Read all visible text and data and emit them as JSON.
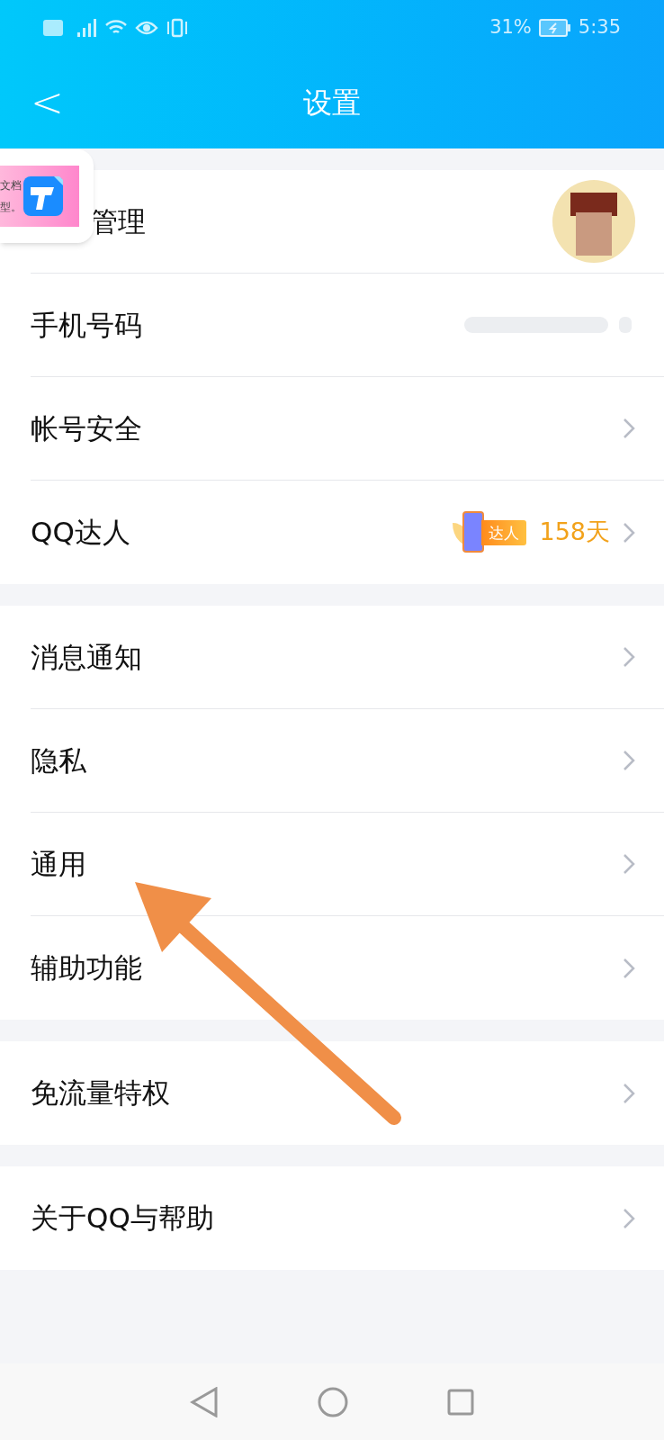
{
  "status_bar": {
    "battery": "31%",
    "time": "5:35"
  },
  "header": {
    "back": "<",
    "title": "设置"
  },
  "floating_widget": {
    "text_1": "文档",
    "text_2": "型。"
  },
  "sections": [
    {
      "rows": [
        {
          "label": "管理",
          "kind": "avatar",
          "covered": true
        },
        {
          "label": "手机号码",
          "kind": "blurred"
        },
        {
          "label": "帐号安全",
          "kind": "chevron"
        },
        {
          "label": "QQ达人",
          "kind": "badge",
          "badge": "达人",
          "value": "158天"
        }
      ]
    },
    {
      "rows": [
        {
          "label": "消息通知",
          "kind": "chevron"
        },
        {
          "label": "隐私",
          "kind": "chevron"
        },
        {
          "label": "通用",
          "kind": "chevron"
        },
        {
          "label": "辅助功能",
          "kind": "chevron"
        }
      ]
    },
    {
      "rows": [
        {
          "label": "免流量特权",
          "kind": "chevron"
        }
      ]
    },
    {
      "rows": [
        {
          "label": "关于QQ与帮助",
          "kind": "chevron"
        }
      ]
    }
  ]
}
